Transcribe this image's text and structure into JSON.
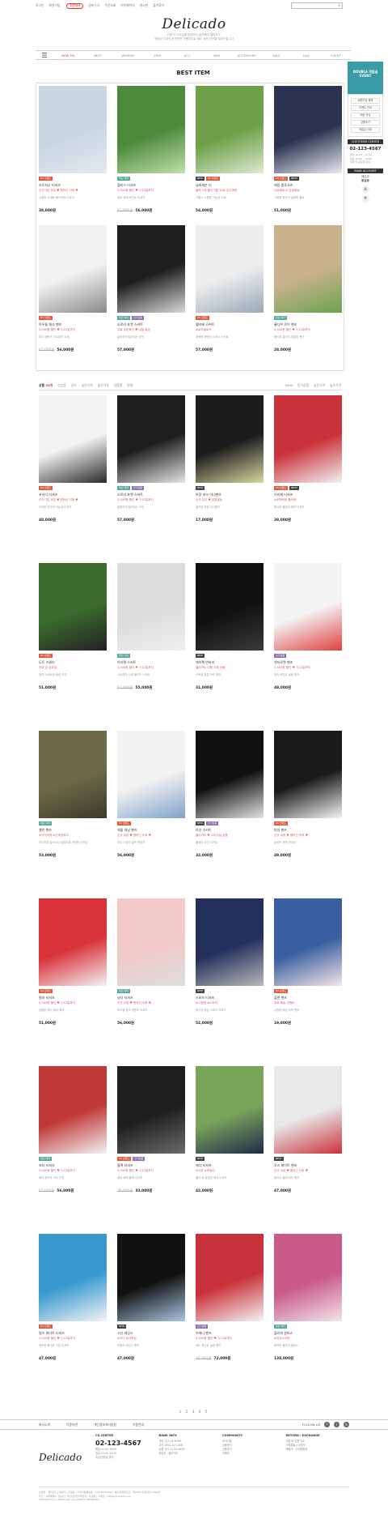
{
  "topbar": {
    "links": [
      "로그인",
      "회원가입",
      "장바구니",
      "주문조회",
      "마이페이지",
      "게시판",
      "즐겨찾기"
    ],
    "join_badge": "회원혜택",
    "search_icon": "search-icon"
  },
  "brand": {
    "logo": "Delicado",
    "tagline": [
      "나만의 스타일을 완성하는 골프웨어 델리카도",
      "세련된 디자인과 편안한 착용감으로 필드 위의 당신을 빛내드립니다"
    ]
  },
  "gnb": {
    "items": [
      "NEW 5%",
      "BEST",
      "WOMEN",
      "MEN",
      "ACC",
      "BAG",
      "ACCESSORY",
      "SALE",
      "QnA",
      "EVENT"
    ],
    "active_index": 0
  },
  "best": {
    "title": "BEST ITEM",
    "products": [
      {
        "img": [
          "#c9d6e2",
          "#e3e8ee"
        ],
        "badges": [
          [
            "#e05a3a",
            "KS 브랜드"
          ]
        ],
        "name": "조르지오 티셔츠",
        "promo": "신규가입 쿠폰 ♥ 원하신 이후 ♥",
        "desc": "시원한 소재와 베이직한 디자인",
        "old": "",
        "price": "38,000원"
      },
      {
        "img": [
          "#4d8a3c",
          "#bfe0a8"
        ],
        "badges": [
          [
            "#5a9",
            "테린 데이"
          ]
        ],
        "name": "헬리스 티셔츠",
        "promo": "5,500원 할인 ♥ 7/12일까지",
        "desc": "컬러 배색 포인트 티셔츠",
        "old": "61,000원",
        "price": "56,000원"
      },
      {
        "img": [
          "#6ea04a",
          "#dfe9cf"
        ],
        "badges": [
          [
            "#444",
            "NEW"
          ],
          [
            "#e05a3a",
            "KS 브랜드"
          ]
        ],
        "name": "넘버세븐 티",
        "promo": "블랙 2개 할인 7월 10일 입고예정",
        "desc": "가볍고 시원한 기능성 소재",
        "old": "",
        "price": "54,000원"
      },
      {
        "img": [
          "#2c3350",
          "#e9ecef"
        ],
        "badges": [
          [
            "#e05a3a",
            "KS 브랜드"
          ],
          [
            "#444",
            "BEST"
          ]
        ],
        "name": "헤링 폴로셔츠",
        "promo": "무료배송 & 당일배송",
        "desc": "시원한 원단의 슬림핏 폴로",
        "old": "",
        "price": "51,000원"
      },
      {
        "img": [
          "#f1f1f1",
          "#8a8a8a"
        ],
        "badges": [
          [
            "#e05a3a",
            "KS 브랜드"
          ]
        ],
        "name": "아우름 체크 팬츠",
        "promo": "5,000원 할인 ♥ 7/12일까지",
        "desc": "체크 패턴의 스트레치 소재",
        "old": "67,000원",
        "price": "56,000원"
      },
      {
        "img": [
          "#1e1e1e",
          "#d9d9d9"
        ],
        "badges": [
          [
            "#5a9",
            "테린 데이"
          ],
          [
            "#8a6fb3",
            "인기상품"
          ]
        ],
        "name": "오로라 포켓 스커트",
        "promo": "무료 주문확인 ♥ 내일 발송",
        "desc": "슬림하게 떨어지는 라인",
        "old": "",
        "price": "57,000원"
      },
      {
        "img": [
          "#eeeeee",
          "#9aa8b8"
        ],
        "badges": [
          [
            "#e05a3a",
            "KS 브랜드"
          ]
        ],
        "name": "헬리베 스커트",
        "promo": "#로즈클로즈",
        "desc": "경쾌한 패턴의 스포티 스커트",
        "old": "",
        "price": "57,000원"
      },
      {
        "img": [
          "#c8b28c",
          "#6ba34f"
        ],
        "badges": [
          [
            "#5a9",
            "테린 데이"
          ]
        ],
        "name": "롱디브 로브 팬츠",
        "promo": "5,500원 할인 ♥ 7/12일까지",
        "desc": "베이지 컬러의 데일리 팬츠",
        "old": "",
        "price": "28,000원"
      }
    ]
  },
  "sidebar": {
    "banner_lines": [
      "DOUBLE 적립금",
      "EVENT"
    ],
    "links": [
      "회원가입 혜택",
      "이벤트 안내",
      "배송 안내",
      "상품후기",
      "적립금 안내"
    ],
    "cs_title": "CUSTOMER CENTER",
    "phone": "02-123-4567",
    "hours": [
      "평일 10:00 - 18:00",
      "점심 12:00 - 13:00",
      "주말 및 공휴일 휴무"
    ],
    "bank_title": "BANK ACCOUNT",
    "bank": [
      "예금주",
      "홍길동"
    ],
    "up_icon": "▲",
    "down_icon": "▼"
  },
  "list": {
    "count_label": "상품",
    "count": "33개",
    "filters": [
      "신상품",
      "인기",
      "낮은가격",
      "높은가격",
      "상품평",
      "판매"
    ],
    "sorts": [
      "NEW",
      "인기상품",
      "낮은가격",
      "높은가격"
    ],
    "products": [
      {
        "img": [
          "#f3f3f3",
          "#2a2a2a"
        ],
        "badges": [
          [
            "#e05a3a",
            "KS 브랜드"
          ]
        ],
        "name": "포카디 티셔츠",
        "promo": "신규가입 쿠폰 ♥ 원하신 이후 ♥",
        "desc": "우아한 라인의 기능성 티셔츠",
        "old": "",
        "price": "48,000원"
      },
      {
        "img": [
          "#1e1e1e",
          "#e5e5e5"
        ],
        "badges": [
          [
            "#5a9",
            "테린 데이"
          ],
          [
            "#8a6fb3",
            "인기상품"
          ]
        ],
        "name": "오로라 포켓 스커트",
        "promo": "5,500원 할인 ♥ 7/12일까지",
        "desc": "슬림하게 떨어지는 라인",
        "old": "",
        "price": "57,000원"
      },
      {
        "img": [
          "#1c1c1c",
          "#d8d8a0"
        ],
        "badges": [
          [
            "#444",
            "NEW"
          ]
        ],
        "name": "보랑 마크 이너팬츠",
        "promo": "신규 입고 ♥ 당일발송",
        "desc": "골프공 포켓 이너팬츠",
        "old": "",
        "price": "17,000원"
      },
      {
        "img": [
          "#c9323a",
          "#f2f2f2"
        ],
        "badges": [
          [
            "#e05a3a",
            "KS 브랜드"
          ],
          [
            "#444",
            "BEST"
          ]
        ],
        "name": "이미제 티셔츠",
        "promo": "#로맨틱한 플라워",
        "desc": "화사한 플라워 패턴 티셔츠",
        "old": "",
        "price": "29,000원"
      },
      {
        "img": [
          "#3b6b2e",
          "#222"
        ],
        "badges": [
          [
            "#e05a3a",
            "KS 브랜드"
          ]
        ],
        "name": "도트 스윙티",
        "promo": "무료 금 금요일",
        "desc": "체크 스커트와 매칭 추천",
        "old": "",
        "price": "51,000원"
      },
      {
        "img": [
          "#dcdcdc",
          "#efefef"
        ],
        "badges": [
          [
            "#5a9",
            "테린 데이"
          ]
        ],
        "name": "아리엘 스커트",
        "promo": "5,500원 할인 ♥ 7/12일까지",
        "desc": "스트레치 소재 플리츠 스커트",
        "old": "61,000원",
        "price": "55,000원"
      },
      {
        "img": [
          "#111",
          "#3a3a3a"
        ],
        "badges": [
          [
            "#444",
            "NEW"
          ]
        ],
        "name": "에이펙 반바지",
        "promo": "델리카도 여름 기획 상품",
        "desc": "신축성 좋은 하프 팬츠",
        "old": "",
        "price": "31,000원"
      },
      {
        "img": [
          "#f4f4f4",
          "#e04040"
        ],
        "badges": [
          [
            "#8a6fb3",
            "인기상품"
          ]
        ],
        "name": "엣지로켓 팬츠",
        "promo": "5,500원 할인 ♥ 7/12일까지",
        "desc": "엣지 포인트 슬림 팬츠",
        "old": "",
        "price": "49,000원"
      },
      {
        "img": [
          "#6d6a48",
          "#3b3a2a"
        ],
        "badges": [
          [
            "#5a9",
            "테린 데이"
          ]
        ],
        "name": "밸런 팬츠",
        "promo": "#낙낙하게 #신축성최고",
        "desc": "어디까지 늘어나나 놀랍도록 편안한 신축성",
        "old": "",
        "price": "53,000원"
      },
      {
        "img": [
          "#f2f2f2",
          "#7fa3c8"
        ],
        "badges": [
          [
            "#e05a3a",
            "KS 브랜드"
          ]
        ],
        "name": "에올 데님 팬츠",
        "promo": "신규 쿠폰 ♥ 원하신 이후 ♥",
        "desc": "데님 느낌의 골프 반바지",
        "old": "",
        "price": "56,000원"
      },
      {
        "img": [
          "#111",
          "#e4e4e4"
        ],
        "badges": [
          [
            "#444",
            "NEW"
          ],
          [
            "#8a6fb3",
            "인기상품"
          ]
        ],
        "name": "라인 스커트",
        "promo": "델리카도 ♥ 오리지널 상품",
        "desc": "플레어 라인 스커트",
        "old": "",
        "price": "32,000원"
      },
      {
        "img": [
          "#1a1a1a",
          "#f5f5f5"
        ],
        "badges": [
          [
            "#e05a3a",
            "KS 브랜드"
          ]
        ],
        "name": "피치 팬츠",
        "promo": "신규 쿠폰 ♥ 원하신 이후 ♥",
        "desc": "슬림핏 포켓 반바지",
        "old": "",
        "price": "49,000원"
      },
      {
        "img": [
          "#d9323a",
          "#f3f3f3"
        ],
        "badges": [
          [
            "#e05a3a",
            "KS 브랜드"
          ]
        ],
        "name": "필라 티셔츠",
        "promo": "5,000원 할인 ♥ 7/12일까지",
        "desc": "강렬한 레드 컬러 배색",
        "old": "",
        "price": "51,000원"
      },
      {
        "img": [
          "#f1c9c9",
          "#dedede"
        ],
        "badges": [
          [
            "#5a9",
            "테린 데이"
          ]
        ],
        "name": "낫타 티셔츠",
        "promo": "신규 쿠폰 ♥ 원하신 이후 ♥",
        "desc": "파스텔 핑크 라운드 티셔츠",
        "old": "",
        "price": "56,000원"
      },
      {
        "img": [
          "#24305c",
          "#b8b8b8"
        ],
        "badges": [
          [
            "#444",
            "NEW"
          ]
        ],
        "name": "스포츠 티셔츠",
        "promo": "#시원함 #스포티",
        "desc": "통기성 좋은 스포티 티셔츠",
        "old": "",
        "price": "52,000원"
      },
      {
        "img": [
          "#3a5fa0",
          "#f3e6e6"
        ],
        "badges": [
          [
            "#e05a3a",
            "KS 브랜드"
          ]
        ],
        "name": "플렌 팬츠",
        "promo": "무료 배송 이벤트",
        "desc": "시원한 데님 하프 팬츠",
        "old": "",
        "price": "19,000원"
      },
      {
        "img": [
          "#c03a3a",
          "#f2f2f2"
        ],
        "badges": [
          [
            "#5a9",
            "테린 데이"
          ]
        ],
        "name": "포터 티셔츠",
        "promo": "5,000원 할인 ♥ 7/12일까지",
        "desc": "체크 팬츠와 코디 추천",
        "old": "61,000원",
        "price": "56,000원"
      },
      {
        "img": [
          "#1e1e1e",
          "#6b6b6b"
        ],
        "badges": [
          [
            "#e05a3a",
            "KS 브랜드"
          ],
          [
            "#8a6fb3",
            "인기상품"
          ]
        ],
        "name": "블랙 티셔츠",
        "promo": "5,000원 할인 ♥ 7/12일까지",
        "desc": "메쉬 배색 블랙 티셔츠",
        "old": "36,000원",
        "price": "33,000원"
      },
      {
        "img": [
          "#7aa35a",
          "#202a4a"
        ],
        "badges": [
          [
            "#444",
            "NEW"
          ]
        ],
        "name": "헤다 티셔츠",
        "promo": "#시원 #데일리",
        "desc": "필드 위 깔끔한 배색 티셔츠",
        "old": "",
        "price": "42,000원"
      },
      {
        "img": [
          "#e8e8e8",
          "#c9323a"
        ],
        "badges": [
          [
            "#444",
            "BEST"
          ]
        ],
        "name": "로스 화이트 팬츠",
        "promo": "신규 쿠폰 ♥ 원하신 이후 ♥",
        "desc": "화이트 컬러 하프 팬츠",
        "old": "",
        "price": "47,000원"
      },
      {
        "img": [
          "#3a9ad0",
          "#f4f4f4"
        ],
        "badges": [
          [
            "#e05a3a",
            "KS 브랜드"
          ]
        ],
        "name": "필즈 화이트 티셔츠",
        "promo": "5,500원 할인 ♥ 7/12일까지",
        "desc": "깨끗한 화이트 기본 티셔츠",
        "old": "",
        "price": "47,000원"
      },
      {
        "img": [
          "#111",
          "#a9c7e2"
        ],
        "badges": [
          [
            "#444",
            "NEW"
          ]
        ],
        "name": "시산 레깅스",
        "promo": "#코디 #신축성",
        "desc": "초밀착 레깅스 팬츠",
        "old": "",
        "price": "47,000원"
      },
      {
        "img": [
          "#c9323a",
          "#f4f4f4"
        ],
        "badges": [
          [
            "#8a6fb3",
            "인기상품"
          ]
        ],
        "name": "우레나 팬츠",
        "promo": "5,500원 할인 ♥ 7/12일까지",
        "desc": "레드 포인트 슬림 팬츠",
        "old": "76,000원",
        "price": "72,000원"
      },
      {
        "img": [
          "#c95a8a",
          "#f1e6e9"
        ],
        "badges": [
          [
            "#5a9",
            "테린 데이"
          ]
        ],
        "name": "플리워 원피스",
        "promo": "#여성스러운",
        "desc": "화려한 플라워 원피스",
        "old": "",
        "price": "138,000원"
      }
    ]
  },
  "pagination": "1 2 3 4 5",
  "footer": {
    "nav": [
      "회사소개",
      "이용약관",
      "개인정보처리방침",
      "이용안내"
    ],
    "follow_label": "FOLLOW US",
    "social": [
      "f",
      "i",
      "b"
    ],
    "logo": "Delicado",
    "cs_title": "CS CENTER",
    "phone": "02-123-4567",
    "cs_lines": [
      "평일 10:00-18:00",
      "점심 12:00-13:00",
      "주말/공휴일 휴무"
    ],
    "bank_title": "BANK INFO",
    "bank_lines": [
      "국민 123-45-6789",
      "우리 1002-123-456",
      "농협 301-1234-5678",
      "예금주 : 델리카도"
    ],
    "community_title": "COMMUNITY",
    "community_lines": [
      "공지사항",
      "상품문의",
      "상품후기",
      "이벤트"
    ],
    "return_title": "RETURN / EXCHANGE",
    "return_lines": [
      "교환 및 반품 주소",
      "서울특별시 강남구",
      "택배사 : CJ대한통운"
    ],
    "info": [
      "상호명 : 델리카도 | 대표자 : 홍길동 | 사업자등록번호 : 123-45-67890 | 통신판매업신고 : 제2024-서울강남-0000호",
      "주소 : 서울특별시 강남구 | 개인정보관리책임자 : 홍길동 | 이메일 : help@delicado.com",
      "COPYRIGHT (C) DELICADO ALL RIGHTS RESERVED."
    ]
  }
}
